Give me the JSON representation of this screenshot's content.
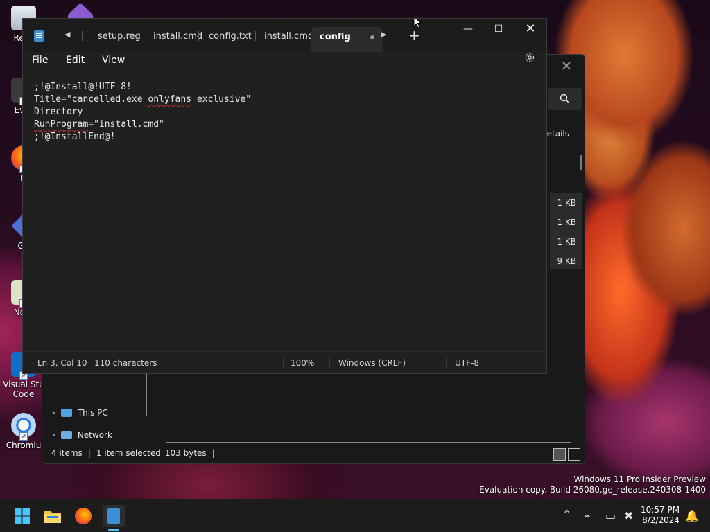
{
  "desktop": {
    "icons": [
      {
        "label": "Recy"
      },
      {
        "label": "Ever"
      },
      {
        "label": "Fi"
      },
      {
        "label": "Git"
      },
      {
        "label": "Note"
      },
      {
        "label": "Visual Stu Code"
      },
      {
        "label": "Chromiu"
      }
    ]
  },
  "explorer": {
    "details_label": "Details",
    "sizes": [
      "1 KB",
      "1 KB",
      "1 KB",
      "9 KB"
    ],
    "nav": [
      {
        "label": "This PC",
        "icon": "monitor-icon"
      },
      {
        "label": "Network",
        "icon": "network-icon"
      }
    ],
    "status": {
      "items": "4 items",
      "selected": "1 item selected",
      "bytes": "103 bytes"
    }
  },
  "notepad": {
    "tabs": [
      {
        "label": "setup.reg"
      },
      {
        "label": "install.cmd"
      },
      {
        "label": "config.txt"
      },
      {
        "label": "install.cmd"
      },
      {
        "label": "config",
        "active": true,
        "unsaved": true
      }
    ],
    "menu": {
      "file": "File",
      "edit": "Edit",
      "view": "View"
    },
    "editor": {
      "line1": ";!@Install@!UTF-8!",
      "line2_a": "Title=\"cancelled.exe ",
      "line2_b": "onlyfans",
      "line2_c": " exclusive\"",
      "line3": "Directory",
      "line4_a": "RunProgram",
      "line4_b": "=\"install.cmd\"",
      "line5": ";!@InstallEnd@!"
    },
    "status": {
      "position": "Ln 3, Col 10",
      "chars": "110 characters",
      "zoom": "100%",
      "line_endings": "Windows (CRLF)",
      "encoding": "UTF-8"
    }
  },
  "watermark": {
    "line1": "Windows 11 Pro Insider Preview",
    "line2": "Evaluation copy. Build 26080.ge_release.240308-1400"
  },
  "taskbar": {
    "apps": [
      "start-icon",
      "file-explorer-icon",
      "firefox-icon",
      "notepad-icon"
    ],
    "time": "10:57 PM",
    "date": "8/2/2024"
  }
}
